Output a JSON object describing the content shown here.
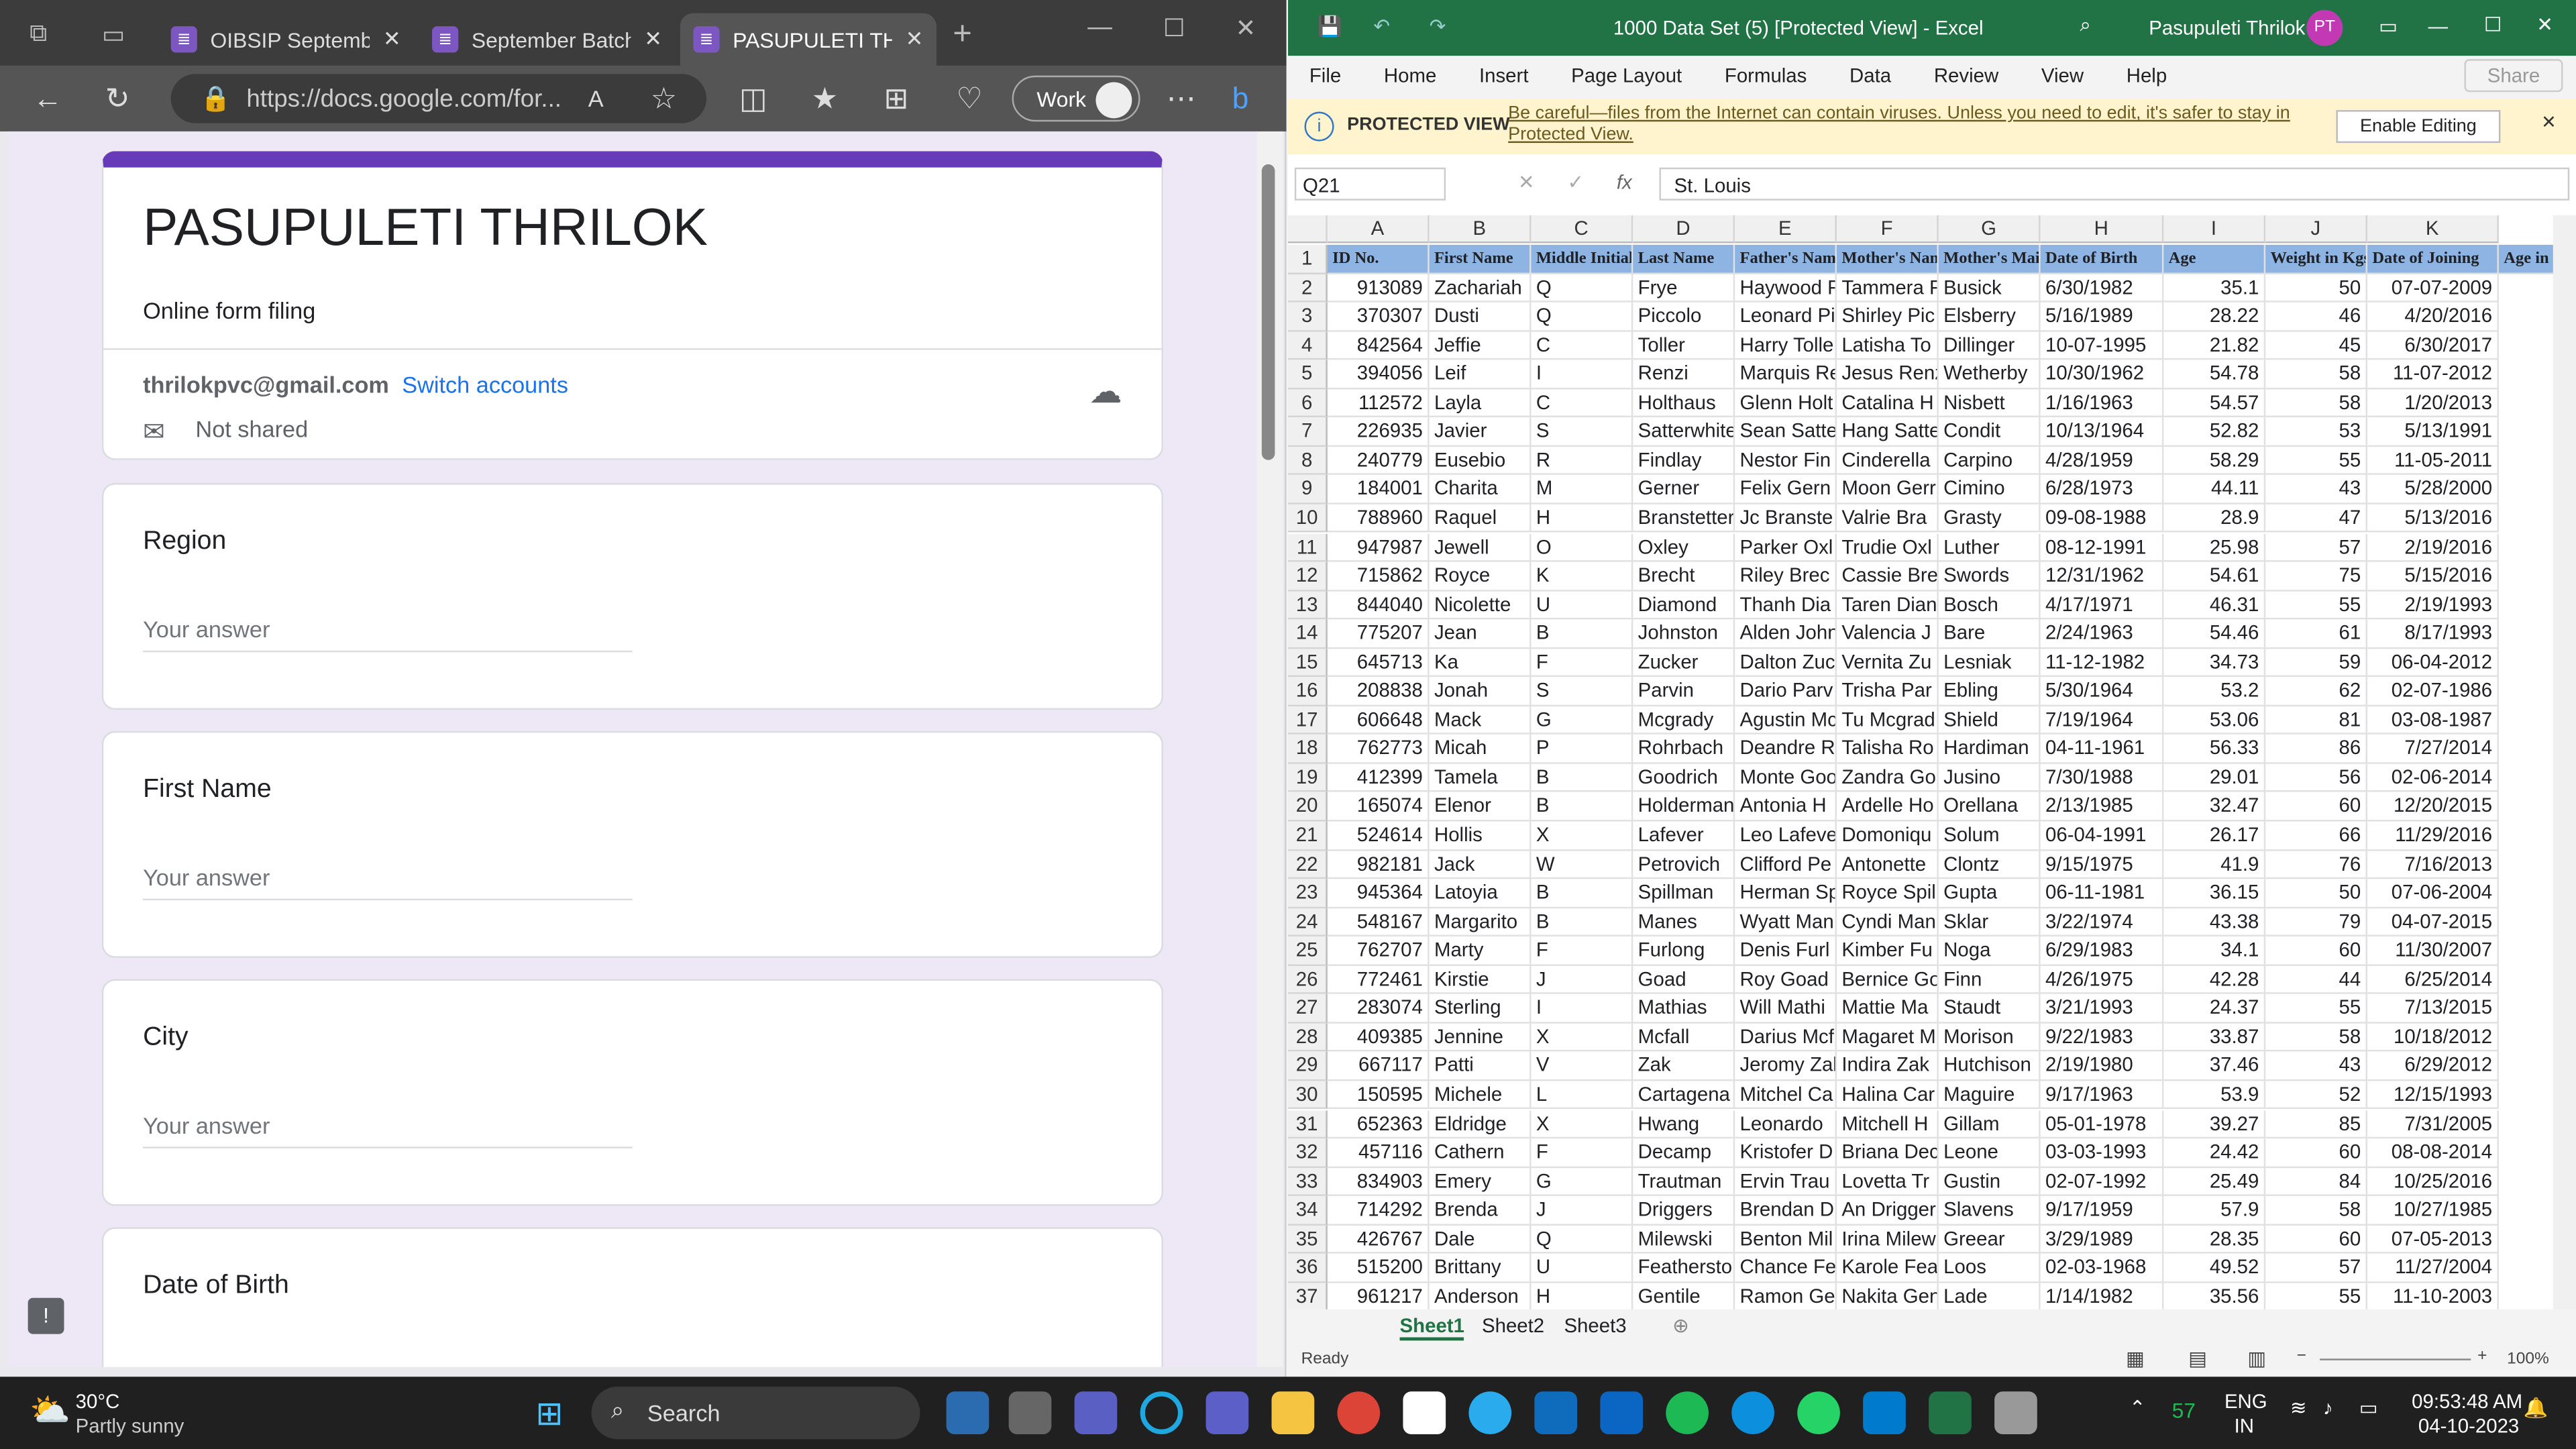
{
  "edge": {
    "tabs": [
      {
        "label": "OIBSIP Septemb",
        "active": false
      },
      {
        "label": "September Batch",
        "active": false
      },
      {
        "label": "PASUPULETI THR",
        "active": true
      }
    ],
    "url": "https://docs.google.com/for...",
    "work_label": "Work"
  },
  "form": {
    "title": "PASUPULETI THRILOK",
    "description": "Online form filing",
    "email": "thrilokpvc@gmail.com",
    "switch_label": "Switch accounts",
    "not_shared": "Not shared",
    "questions": [
      {
        "label": "Region",
        "placeholder": "Your answer"
      },
      {
        "label": "First Name",
        "placeholder": "Your answer"
      },
      {
        "label": "City",
        "placeholder": "Your answer"
      },
      {
        "label": "Date of Birth",
        "placeholder": ""
      }
    ]
  },
  "excel": {
    "title": "1000 Data Set (5) [Protected View] - Excel",
    "user": "Pasupuleti Thrilok",
    "initials": "PT",
    "menu": [
      "File",
      "Home",
      "Insert",
      "Page Layout",
      "Formulas",
      "Data",
      "Review",
      "View",
      "Help"
    ],
    "share": "Share",
    "protected_label": "PROTECTED VIEW",
    "protected_msg": "Be careful—files from the Internet can contain viruses. Unless you need to edit, it's safer to stay in Protected View.",
    "enable_editing": "Enable Editing",
    "name_box": "Q21",
    "formula": "St. Louis",
    "columns": [
      "A",
      "B",
      "C",
      "D",
      "E",
      "F",
      "G",
      "H",
      "I",
      "J",
      "K"
    ],
    "header_row": [
      "ID No.",
      "First Name",
      "Middle Initial",
      "Last Name",
      "Father's Nam",
      "Mother's Nam",
      "Mother's Mai",
      "Date of Birth",
      "Age",
      "Weight in Kgs",
      "Date of Joining",
      "Age in"
    ],
    "rows": [
      [
        "913089",
        "Zachariah",
        "Q",
        "Frye",
        "Haywood F",
        "Tammera F",
        "Busick",
        "6/30/1982",
        "35.1",
        "50",
        "07-07-2009"
      ],
      [
        "370307",
        "Dusti",
        "Q",
        "Piccolo",
        "Leonard Pi",
        "Shirley Pic",
        "Elsberry",
        "5/16/1989",
        "28.22",
        "46",
        "4/20/2016"
      ],
      [
        "842564",
        "Jeffie",
        "C",
        "Toller",
        "Harry Tolle",
        "Latisha To",
        "Dillinger",
        "10-07-1995",
        "21.82",
        "45",
        "6/30/2017"
      ],
      [
        "394056",
        "Leif",
        "I",
        "Renzi",
        "Marquis Re",
        "Jesus Renz",
        "Wetherby",
        "10/30/1962",
        "54.78",
        "58",
        "11-07-2012"
      ],
      [
        "112572",
        "Layla",
        "C",
        "Holthaus",
        "Glenn Holt",
        "Catalina H",
        "Nisbett",
        "1/16/1963",
        "54.57",
        "58",
        "1/20/2013"
      ],
      [
        "226935",
        "Javier",
        "S",
        "Satterwhite",
        "Sean Satte",
        "Hang Satte",
        "Condit",
        "10/13/1964",
        "52.82",
        "53",
        "5/13/1991"
      ],
      [
        "240779",
        "Eusebio",
        "R",
        "Findlay",
        "Nestor Fin",
        "Cinderella",
        "Carpino",
        "4/28/1959",
        "58.29",
        "55",
        "11-05-2011"
      ],
      [
        "184001",
        "Charita",
        "M",
        "Gerner",
        "Felix Gern",
        "Moon Gerr",
        "Cimino",
        "6/28/1973",
        "44.11",
        "43",
        "5/28/2000"
      ],
      [
        "788960",
        "Raquel",
        "H",
        "Branstetter",
        "Jc Branste",
        "Valrie Bra",
        "Grasty",
        "09-08-1988",
        "28.9",
        "47",
        "5/13/2016"
      ],
      [
        "947987",
        "Jewell",
        "O",
        "Oxley",
        "Parker Oxl",
        "Trudie Oxl",
        "Luther",
        "08-12-1991",
        "25.98",
        "57",
        "2/19/2016"
      ],
      [
        "715862",
        "Royce",
        "K",
        "Brecht",
        "Riley Brec",
        "Cassie Bre",
        "Swords",
        "12/31/1962",
        "54.61",
        "75",
        "5/15/2016"
      ],
      [
        "844040",
        "Nicolette",
        "U",
        "Diamond",
        "Thanh Dia",
        "Taren Dian",
        "Bosch",
        "4/17/1971",
        "46.31",
        "55",
        "2/19/1993"
      ],
      [
        "775207",
        "Jean",
        "B",
        "Johnston",
        "Alden John",
        "Valencia J",
        "Bare",
        "2/24/1963",
        "54.46",
        "61",
        "8/17/1993"
      ],
      [
        "645713",
        "Ka",
        "F",
        "Zucker",
        "Dalton Zuc",
        "Vernita Zu",
        "Lesniak",
        "11-12-1982",
        "34.73",
        "59",
        "06-04-2012"
      ],
      [
        "208838",
        "Jonah",
        "S",
        "Parvin",
        "Dario Parv",
        "Trisha Par",
        "Ebling",
        "5/30/1964",
        "53.2",
        "62",
        "02-07-1986"
      ],
      [
        "606648",
        "Mack",
        "G",
        "Mcgrady",
        "Agustin Mc",
        "Tu Mcgrad",
        "Shield",
        "7/19/1964",
        "53.06",
        "81",
        "03-08-1987"
      ],
      [
        "762773",
        "Micah",
        "P",
        "Rohrbach",
        "Deandre R",
        "Talisha Ro",
        "Hardiman",
        "04-11-1961",
        "56.33",
        "86",
        "7/27/2014"
      ],
      [
        "412399",
        "Tamela",
        "B",
        "Goodrich",
        "Monte Goo",
        "Zandra Go",
        "Jusino",
        "7/30/1988",
        "29.01",
        "56",
        "02-06-2014"
      ],
      [
        "165074",
        "Elenor",
        "B",
        "Holderman",
        "Antonia H",
        "Ardelle Ho",
        "Orellana",
        "2/13/1985",
        "32.47",
        "60",
        "12/20/2015"
      ],
      [
        "524614",
        "Hollis",
        "X",
        "Lafever",
        "Leo Lafeve",
        "Domoniqu",
        "Solum",
        "06-04-1991",
        "26.17",
        "66",
        "11/29/2016"
      ],
      [
        "982181",
        "Jack",
        "W",
        "Petrovich",
        "Clifford Pe",
        "Antonette",
        "Clontz",
        "9/15/1975",
        "41.9",
        "76",
        "7/16/2013"
      ],
      [
        "945364",
        "Latoyia",
        "B",
        "Spillman",
        "Herman Sp",
        "Royce Spil",
        "Gupta",
        "06-11-1981",
        "36.15",
        "50",
        "07-06-2004"
      ],
      [
        "548167",
        "Margarito",
        "B",
        "Manes",
        "Wyatt Man",
        "Cyndi Man",
        "Sklar",
        "3/22/1974",
        "43.38",
        "79",
        "04-07-2015"
      ],
      [
        "762707",
        "Marty",
        "F",
        "Furlong",
        "Denis Furl",
        "Kimber Fu",
        "Noga",
        "6/29/1983",
        "34.1",
        "60",
        "11/30/2007"
      ],
      [
        "772461",
        "Kirstie",
        "J",
        "Goad",
        "Roy Goad",
        "Bernice Go",
        "Finn",
        "4/26/1975",
        "42.28",
        "44",
        "6/25/2014"
      ],
      [
        "283074",
        "Sterling",
        "I",
        "Mathias",
        "Will Mathi",
        "Mattie Ma",
        "Staudt",
        "3/21/1993",
        "24.37",
        "55",
        "7/13/2015"
      ],
      [
        "409385",
        "Jennine",
        "X",
        "Mcfall",
        "Darius Mcf",
        "Magaret M",
        "Morison",
        "9/22/1983",
        "33.87",
        "58",
        "10/18/2012"
      ],
      [
        "667117",
        "Patti",
        "V",
        "Zak",
        "Jeromy Zak",
        "Indira Zak",
        "Hutchison",
        "2/19/1980",
        "37.46",
        "43",
        "6/29/2012"
      ],
      [
        "150595",
        "Michele",
        "L",
        "Cartagena",
        "Mitchel Ca",
        "Halina Car",
        "Maguire",
        "9/17/1963",
        "53.9",
        "52",
        "12/15/1993"
      ],
      [
        "652363",
        "Eldridge",
        "X",
        "Hwang",
        "Leonardo",
        "Mitchell H",
        "Gillam",
        "05-01-1978",
        "39.27",
        "85",
        "7/31/2005"
      ],
      [
        "457116",
        "Cathern",
        "F",
        "Decamp",
        "Kristofer D",
        "Briana Dec",
        "Leone",
        "03-03-1993",
        "24.42",
        "60",
        "08-08-2014"
      ],
      [
        "834903",
        "Emery",
        "G",
        "Trautman",
        "Ervin Trau",
        "Lovetta Tr",
        "Gustin",
        "02-07-1992",
        "25.49",
        "84",
        "10/25/2016"
      ],
      [
        "714292",
        "Brenda",
        "J",
        "Driggers",
        "Brendan D",
        "An Drigger",
        "Slavens",
        "9/17/1959",
        "57.9",
        "58",
        "10/27/1985"
      ],
      [
        "426767",
        "Dale",
        "Q",
        "Milewski",
        "Benton Mil",
        "Irina Milew",
        "Greear",
        "3/29/1989",
        "28.35",
        "60",
        "07-05-2013"
      ],
      [
        "515200",
        "Brittany",
        "U",
        "Featherstone",
        "Chance Fea",
        "Karole Fea",
        "Loos",
        "02-03-1968",
        "49.52",
        "57",
        "11/27/2004"
      ],
      [
        "961217",
        "Anderson",
        "H",
        "Gentile",
        "Ramon Ger",
        "Nakita Gen",
        "Lade",
        "1/14/1982",
        "35.56",
        "55",
        "11-10-2003"
      ]
    ],
    "sheets": [
      "Sheet1",
      "Sheet2",
      "Sheet3"
    ],
    "status": "Ready",
    "zoom": "100%"
  },
  "taskbar": {
    "weather_temp": "30°C",
    "weather_desc": "Partly sunny",
    "search": "Search",
    "lang": "ENG",
    "region": "IN",
    "time": "09:53:48 AM",
    "date": "04-10-2023",
    "badge": "57"
  }
}
